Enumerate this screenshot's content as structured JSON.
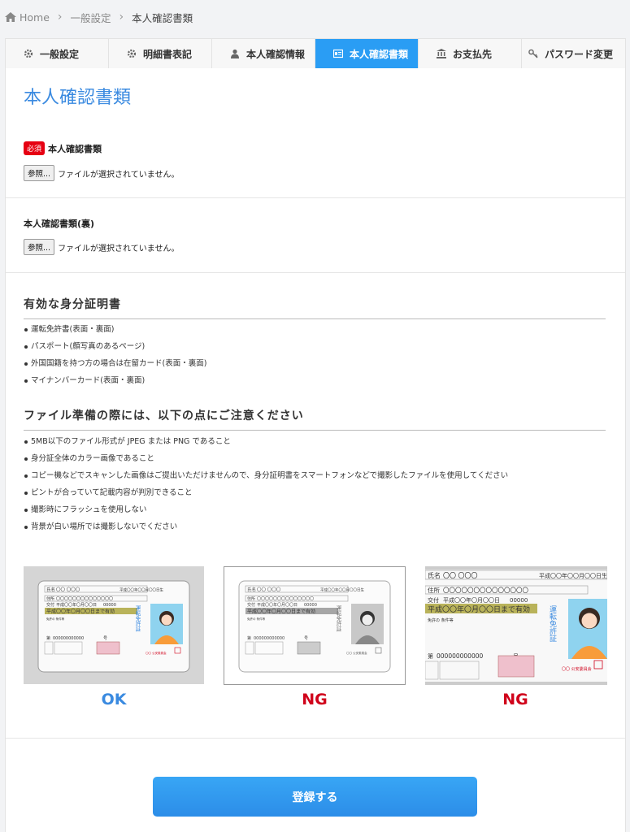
{
  "breadcrumb": {
    "home": "Home",
    "parent": "一般設定",
    "current": "本人確認書類"
  },
  "tabs": [
    {
      "label": "一般設定",
      "icon": "gear-icon"
    },
    {
      "label": "明細書表記",
      "icon": "gear-icon"
    },
    {
      "label": "本人確認情報",
      "icon": "user-icon"
    },
    {
      "label": "本人確認書類",
      "icon": "id-card-icon",
      "active": true
    },
    {
      "label": "お支払先",
      "icon": "bank-icon"
    },
    {
      "label": "パスワード変更",
      "icon": "key-icon"
    }
  ],
  "page_title": "本人確認書類",
  "upload_front": {
    "required_badge": "必須",
    "label": "本人確認書類",
    "button": "参照...",
    "status": "ファイルが選択されていません。"
  },
  "upload_back": {
    "label": "本人確認書類(裏)",
    "button": "参照...",
    "status": "ファイルが選択されていません。"
  },
  "valid_ids": {
    "heading": "有効な身分証明書",
    "items": [
      "運転免許書(表面・裏面)",
      "パスポート(顔写真のあるページ)",
      "外国国籍を持つ方の場合は在留カード(表面・裏面)",
      "マイナンバーカード(表面・裏面)"
    ]
  },
  "notes": {
    "heading": "ファイル準備の際には、以下の点にご注意ください",
    "items": [
      "5MB以下のファイル形式が JPEG または PNG であること",
      "身分証全体のカラー画像であること",
      "コピー機などでスキャンした画像はご提出いただけませんので、身分証明書をスマートフォンなどで撮影したファイルを使用してください",
      "ピントが合っていて記載内容が判別できること",
      "撮影時にフラッシュを使用しない",
      "背景が白い場所では撮影しないでください"
    ]
  },
  "samples": [
    {
      "label": "OK",
      "color": "#3a8ae0"
    },
    {
      "label": "NG",
      "color": "#d0021b"
    },
    {
      "label": "NG",
      "color": "#d0021b"
    }
  ],
  "card": {
    "name_label": "氏名",
    "name_value": "〇〇 〇〇〇",
    "dob": "平成〇〇年〇〇月〇〇日生",
    "address_label": "住所",
    "address_value": "〇〇〇〇〇〇〇〇〇〇〇〇〇〇",
    "issued_label": "交付",
    "issued_value": "平成〇〇年〇月〇〇日",
    "issued_no": "00000",
    "valid_until": "平成〇〇年〇月〇〇日まで有効",
    "conditions": "免許の 条件等",
    "number_label": "第",
    "number_value": "000000000000",
    "number_suffix": "号",
    "vertical_title": "運転免許証",
    "issuer": "〇〇 公安委員会"
  },
  "submit_label": "登録する"
}
